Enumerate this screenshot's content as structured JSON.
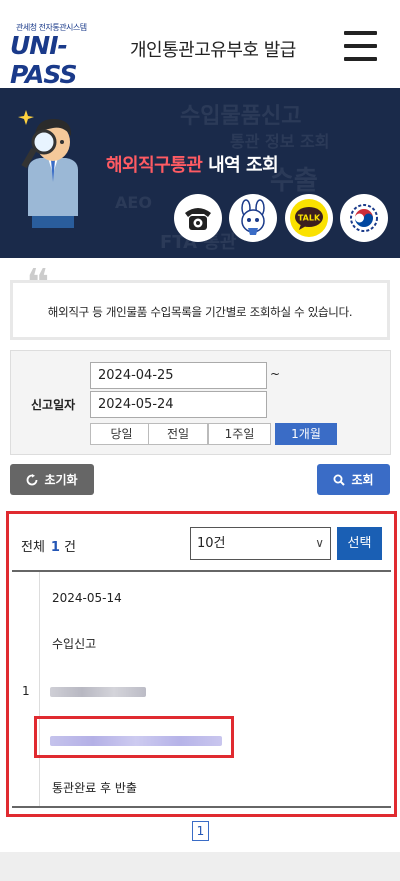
{
  "header": {
    "logo_small": "관세청 전자통관시스템",
    "logo_main": "UNI-PASS",
    "title": "개인통관고유부호 발급",
    "menu_icon": "hamburger-icon"
  },
  "banner": {
    "title_highlight": "해외직구통관",
    "title_rest": " 내역 조회",
    "icons": [
      "phone-icon",
      "mascot-icon",
      "kakaotalk-icon",
      "government-emblem-icon"
    ],
    "talk_label": "TALK"
  },
  "notice": {
    "text": "해외직구 등 개인물품 수입목록을 기간별로 조회하실 수 있습니다."
  },
  "search": {
    "label": "신고일자",
    "date_from": "2024-04-25",
    "date_to": "2024-05-24",
    "tilde": "~",
    "periods": [
      "당일",
      "전일",
      "1주일",
      "1개월"
    ],
    "active_period": "1개월"
  },
  "actions": {
    "reset_label": "초기화",
    "search_label": "조회"
  },
  "results": {
    "total_label": "전체",
    "count": "1",
    "count_unit": "건",
    "page_size": "10건",
    "choose_label": "선택",
    "rows": [
      {
        "no": "1",
        "date": "2024-05-14",
        "type": "수입신고",
        "status": "통관완료 후 반출"
      }
    ]
  },
  "pager": {
    "current": "1"
  },
  "colors": {
    "accent": "#3a6cc6",
    "highlight": "#e02a30",
    "banner_bg": "#1a2a4a",
    "title_red": "#ff5b63"
  }
}
